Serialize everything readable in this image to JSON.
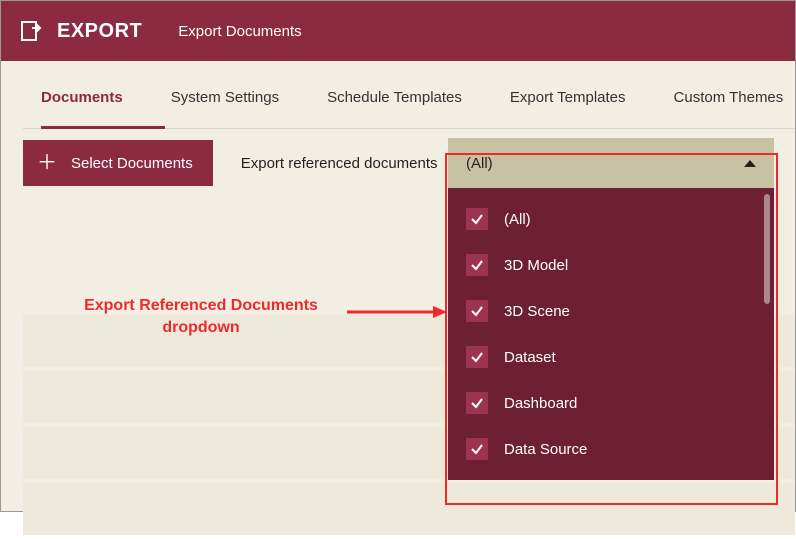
{
  "header": {
    "title": "EXPORT",
    "subtitle": "Export Documents"
  },
  "tabs": [
    {
      "label": "Documents",
      "active": true
    },
    {
      "label": "System Settings",
      "active": false
    },
    {
      "label": "Schedule Templates",
      "active": false
    },
    {
      "label": "Export Templates",
      "active": false
    },
    {
      "label": "Custom Themes",
      "active": false
    }
  ],
  "toolbar": {
    "select_button": "Select Documents",
    "ref_label": "Export referenced documents"
  },
  "dropdown": {
    "selected": "(All)",
    "options": [
      {
        "label": "(All)",
        "checked": true
      },
      {
        "label": "3D Model",
        "checked": true
      },
      {
        "label": "3D Scene",
        "checked": true
      },
      {
        "label": "Dataset",
        "checked": true
      },
      {
        "label": "Dashboard",
        "checked": true
      },
      {
        "label": "Data Source",
        "checked": true
      }
    ]
  },
  "annotation": {
    "line1": "Export Referenced Documents",
    "line2": "dropdown"
  }
}
